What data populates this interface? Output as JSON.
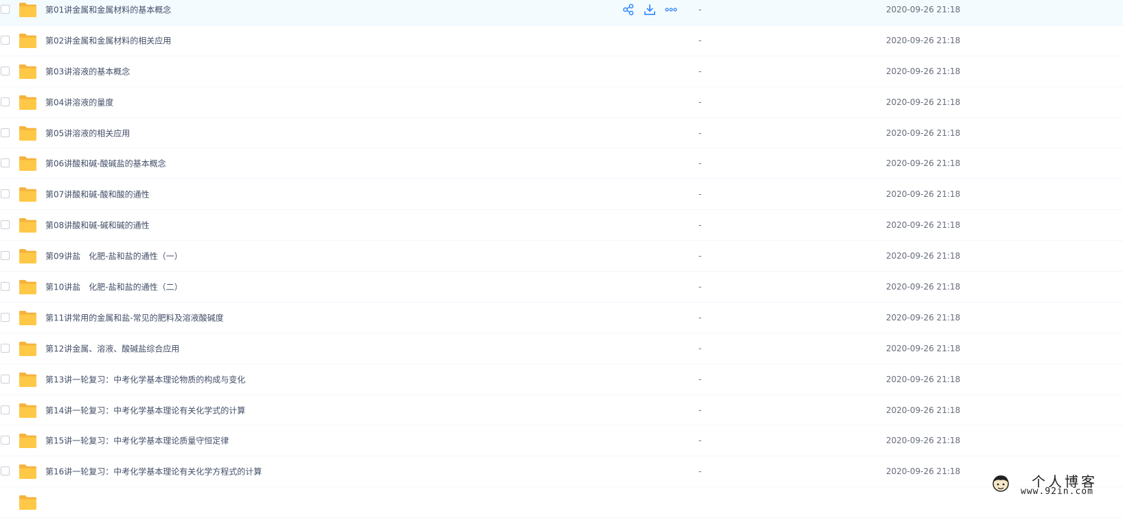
{
  "colors": {
    "folder": "#ffc847",
    "folder_dark": "#f5b33e",
    "action": "#3b8cff",
    "text": "#424e67",
    "muted": "#666c7a"
  },
  "row_actions": {
    "share_icon": "share-icon",
    "download_icon": "download-icon",
    "more_icon": "more-icon"
  },
  "files": [
    {
      "name": "第01讲金属和金属材料的基本概念",
      "size": "-",
      "date": "2020-09-26 21:18"
    },
    {
      "name": "第02讲金属和金属材料的相关应用",
      "size": "-",
      "date": "2020-09-26 21:18"
    },
    {
      "name": "第03讲溶液的基本概念",
      "size": "-",
      "date": "2020-09-26 21:18"
    },
    {
      "name": "第04讲溶液的量度",
      "size": "-",
      "date": "2020-09-26 21:18"
    },
    {
      "name": "第05讲溶液的相关应用",
      "size": "-",
      "date": "2020-09-26 21:18"
    },
    {
      "name": "第06讲酸和碱-酸碱盐的基本概念",
      "size": "-",
      "date": "2020-09-26 21:18"
    },
    {
      "name": "第07讲酸和碱-酸和酸的通性",
      "size": "-",
      "date": "2020-09-26 21:18"
    },
    {
      "name": "第08讲酸和碱-碱和碱的通性",
      "size": "-",
      "date": "2020-09-26 21:18"
    },
    {
      "name": "第09讲盐　化肥-盐和盐的通性（一）",
      "size": "-",
      "date": "2020-09-26 21:18"
    },
    {
      "name": "第10讲盐　化肥-盐和盐的通性（二）",
      "size": "-",
      "date": "2020-09-26 21:18"
    },
    {
      "name": "第11讲常用的金属和盐-常见的肥料及溶液酸碱度",
      "size": "-",
      "date": "2020-09-26 21:18"
    },
    {
      "name": "第12讲金属、溶液、酸碱盐综合应用",
      "size": "-",
      "date": "2020-09-26 21:18"
    },
    {
      "name": "第13讲一轮复习：中考化学基本理论物质的构成与变化",
      "size": "-",
      "date": "2020-09-26 21:18"
    },
    {
      "name": "第14讲一轮复习：中考化学基本理论有关化学式的计算",
      "size": "-",
      "date": "2020-09-26 21:18"
    },
    {
      "name": "第15讲一轮复习：中考化学基本理论质量守恒定律",
      "size": "-",
      "date": "2020-09-26 21:18"
    },
    {
      "name": "第16讲一轮复习：中考化学基本理论有关化学方程式的计算",
      "size": "-",
      "date": "2020-09-26 21:18"
    }
  ],
  "watermark": {
    "title": "个人博客",
    "url": "www.92in.com"
  }
}
